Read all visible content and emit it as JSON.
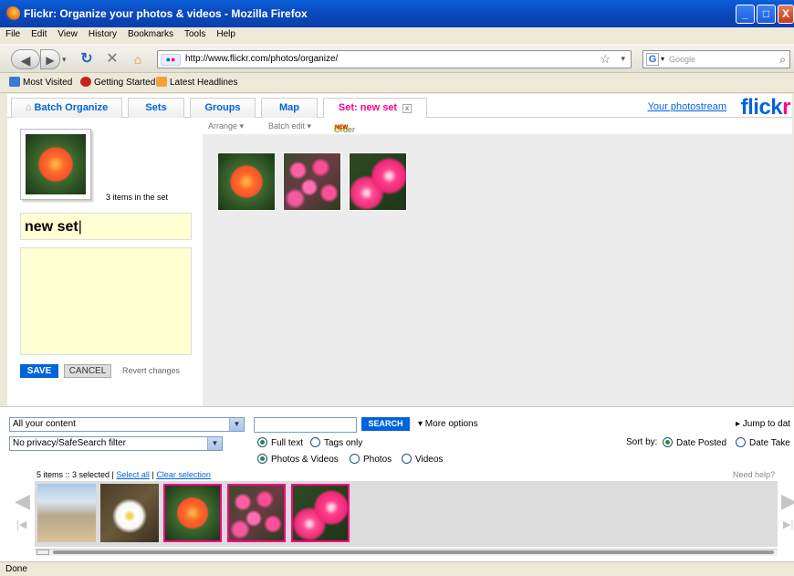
{
  "window": {
    "title": "Flickr: Organize your photos & videos - Mozilla Firefox",
    "minimize": "_",
    "maximize": "□",
    "close": "X"
  },
  "menu": [
    "File",
    "Edit",
    "View",
    "History",
    "Bookmarks",
    "Tools",
    "Help"
  ],
  "nav": {
    "url": "http://www.flickr.com/photos/organize/",
    "site_badge": "●●",
    "search_placeholder": "Google",
    "search_engine": "G"
  },
  "bookmarks": [
    "Most Visited",
    "Getting Started",
    "Latest Headlines"
  ],
  "tabs": {
    "items": [
      "Batch Organize",
      "Sets",
      "Groups",
      "Map",
      "Set: new set"
    ],
    "active": "Set: new set",
    "your_photostream": "Your photostream",
    "logo_fl": "flick",
    "logo_r": "r"
  },
  "set_editor": {
    "items_count": "3 items in the set",
    "title_value": "new set",
    "description_value": "",
    "save": "SAVE",
    "cancel": "CANCEL",
    "revert": "Revert changes"
  },
  "workarea": {
    "arrange": "Arrange ▾",
    "batch_edit": "Batch edit ▾",
    "new_badge": "NEW",
    "order_prints": "Order prints",
    "photos": [
      "orange hibiscus",
      "pink flower cluster",
      "pink hibiscus"
    ]
  },
  "filters": {
    "content_select": "All your content",
    "privacy_select": "No privacy/SafeSearch filter",
    "search_value": "",
    "search_button": "SEARCH",
    "more_options": "▾ More options",
    "jump_to": "▸ Jump to dat",
    "full_text": "Full text",
    "tags_only": "Tags only",
    "photos_videos": "Photos & Videos",
    "photos": "Photos",
    "videos": "Videos",
    "sort_by": "Sort by:",
    "date_posted": "Date Posted",
    "date_taken": "Date Take"
  },
  "filmstrip": {
    "selection_info": "5 items :: 3 selected |",
    "select_all": "Select all",
    "separator": "|",
    "clear_selection": "Clear selection",
    "need_help": "Need help?",
    "thumbs": [
      "beach scene",
      "white plumeria",
      "orange hibiscus",
      "pink flower cluster",
      "pink hibiscus"
    ],
    "selected_indices": [
      2,
      3,
      4
    ]
  },
  "status": "Done",
  "colors": {
    "flickr_blue": "#0063dc",
    "flickr_pink": "#ff0084",
    "title_field": "#ffffd3"
  }
}
